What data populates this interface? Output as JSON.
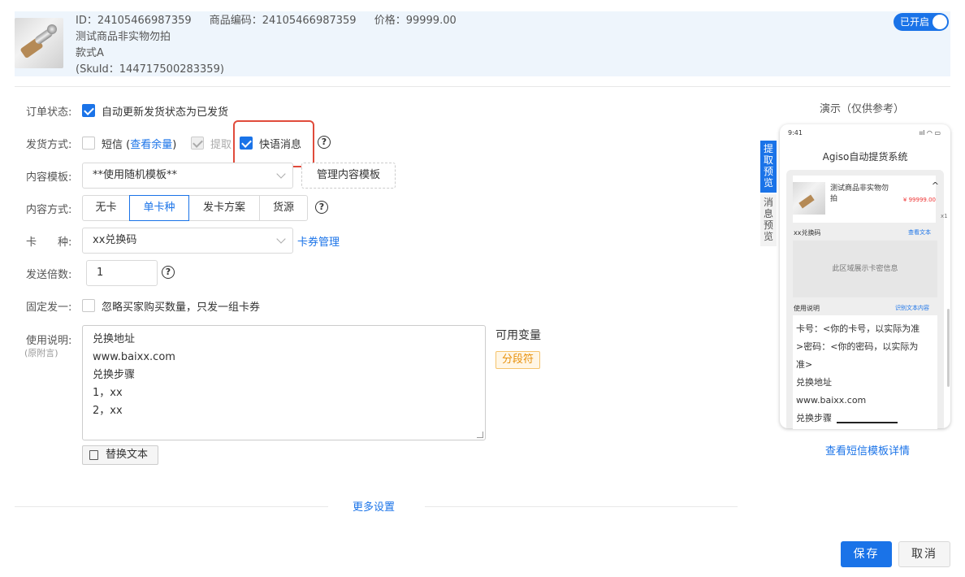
{
  "product": {
    "id_label": "ID：24105466987359",
    "code_label": "商品编码：24105466987359",
    "price_label": "价格：99999.00",
    "name": "测试商品非实物勿拍",
    "style": "款式A",
    "sku": "(SkuId：144717500283359)",
    "toggle_label": "已开启"
  },
  "form": {
    "order_status": {
      "label": "订单状态:",
      "checkbox_text": "自动更新发货状态为已发货",
      "checked": true
    },
    "ship_method": {
      "label": "发货方式:",
      "sms": "短信",
      "sms_quota_open": "(",
      "sms_quota_link": "查看余量",
      "sms_quota_close": ")",
      "pickup": "提取",
      "quick_msg": "快语消息"
    },
    "template": {
      "label": "内容模板:",
      "value": "**使用随机模板**",
      "manage_button": "管理内容模板"
    },
    "content_method": {
      "label": "内容方式:",
      "options": [
        "无卡",
        "单卡种",
        "发卡方案",
        "货源"
      ],
      "active": "单卡种"
    },
    "card_type": {
      "label": "卡　　种:",
      "value": "xx兑换码",
      "manage_link": "卡券管理"
    },
    "send_multiple": {
      "label": "发送倍数:",
      "value": "1"
    },
    "fixed_one": {
      "label": "固定发一:",
      "checkbox_text": "忽略买家购买数量，只发一组卡券"
    },
    "instructions": {
      "label": "使用说明:",
      "sublabel": "(原附言)",
      "lines": [
        "兑换地址",
        "www.baixx.com",
        "兑换步骤",
        "1，xx",
        "2，xx"
      ],
      "replace_button": "替换文本"
    },
    "variables": {
      "title": "可用变量",
      "tag": "分段符"
    },
    "more_settings": "更多设置"
  },
  "preview": {
    "title": "演示（仅供参考）",
    "tab_pickup": "提取预览",
    "tab_msg": "消息预览",
    "time": "9:41",
    "status_icons": "ııl ◠ ▭",
    "app_title": "Agiso自动提货系统",
    "product_name": "测试商品非实物勿拍",
    "price": "¥ 99999.00",
    "qty": "x1",
    "code_label": "xx兑换码",
    "view_text": "查看文本",
    "card_area": "此区域展示卡密信息",
    "usage_label": "使用说明",
    "usage_link": "识别文本内容",
    "usage_lines": [
      "卡号：<你的卡号，以实际为准",
      ">密码：<你的密码，以实际为",
      "准>",
      "兑换地址",
      "www.baixx.com",
      "兑换步骤"
    ],
    "sms_detail_link": "查看短信模板详情"
  },
  "actions": {
    "save": "保存",
    "cancel": "取消"
  },
  "colors": {
    "accent": "#1a73e8",
    "highlight": "#e04b3b",
    "tag": "#e8910c"
  }
}
